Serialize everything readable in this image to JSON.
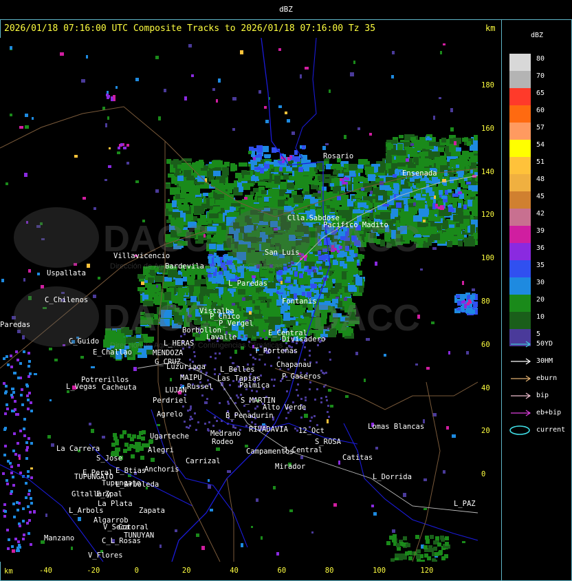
{
  "window": {
    "title": "dBZ"
  },
  "header": {
    "text": "2026/01/18 07:16:00 UTC Composite Tracks to 2026/01/18 07:16:00 Tz 35",
    "unit": "km"
  },
  "legend": {
    "title": "dBZ",
    "scale": [
      {
        "v": "80",
        "c": "#d8d8d8"
      },
      {
        "v": "70",
        "c": "#b4b4b4"
      },
      {
        "v": "65",
        "c": "#ff3a2a"
      },
      {
        "v": "60",
        "c": "#ff6a10"
      },
      {
        "v": "57",
        "c": "#ff9a60"
      },
      {
        "v": "54",
        "c": "#ffff00"
      },
      {
        "v": "51",
        "c": "#ffc23a"
      },
      {
        "v": "48",
        "c": "#f0b040"
      },
      {
        "v": "45",
        "c": "#d08030"
      },
      {
        "v": "42",
        "c": "#c87090"
      },
      {
        "v": "39",
        "c": "#d01ea0"
      },
      {
        "v": "36",
        "c": "#8a2ae0"
      },
      {
        "v": "35",
        "c": "#3050f0"
      },
      {
        "v": "30",
        "c": "#1e8ae0"
      },
      {
        "v": "20",
        "c": "#1a8a1a"
      },
      {
        "v": "10",
        "c": "#1a5e1a"
      },
      {
        "v": "5",
        "c": "#4a3a9a"
      }
    ],
    "tracks": [
      {
        "label": "50YD",
        "color": "#40c8d8"
      },
      {
        "label": "30HM",
        "color": "#ffffff"
      },
      {
        "label": "eburn",
        "color": "#e0b070"
      },
      {
        "label": "bip",
        "color": "#f0c0d0"
      },
      {
        "label": "eb+bip",
        "color": "#e040e0"
      },
      {
        "label": "current",
        "color": "#40e0e8"
      }
    ]
  },
  "axes": {
    "x_unit": "km",
    "x_ticks": [
      "-40",
      "-20",
      "0",
      "20",
      "40",
      "60",
      "80",
      "100",
      "120"
    ],
    "y_ticks": [
      "180",
      "160",
      "140",
      "120",
      "100",
      "80",
      "60",
      "40",
      "20",
      "0"
    ]
  },
  "watermark": {
    "text": "DACC",
    "subtitle": "Dirección de Agricultura y Contingencias Climáticas"
  },
  "places": [
    "Rosario",
    "Ensenada",
    "Clla.Sabdose",
    "Pacifico Madito",
    "San Luis",
    "Villavicencio",
    "Uspallata",
    "C_Chilenos",
    "Paredas",
    "Bardevila",
    "Vistalba",
    "L_Paredas",
    "P_Chico",
    "P_Vergel",
    "Borbollon",
    "Lavalle",
    "C_Guido",
    "E_Challao",
    "L_HERAS",
    "MENDOZA",
    "G_CRUZ",
    "Luzuriaga",
    "MAIPU",
    "Russel",
    "LUJAN",
    "Potrerillos",
    "L_Vegas",
    "Cacheuta",
    "Perdriel",
    "Agrelo",
    "Ugarteche",
    "La Carrera",
    "S_Jose",
    "E_Peral",
    "TUPUNGATO",
    "Tupungato",
    "E_Btias",
    "Anchoris",
    "Carrizal",
    "Gltallary",
    "E_Zpal",
    "L_Arboleda",
    "La Plata",
    "L_Arbols",
    "Zapata",
    "Algarrob",
    "V_Seca",
    "Manzano",
    "TUNUYAN",
    "Cotoral",
    "C_L_Rosas",
    "V_Flores",
    "Medrano",
    "Rodeo",
    "Campamentos",
    "Mirador",
    "L_Dorrida",
    "Catitas",
    "S_ROSA",
    "Lomas Blancas",
    "L_PAZ",
    "12_Oct",
    "Divisadero",
    "E_Central",
    "T_Porteñas",
    "L_Belles",
    "Chapanau",
    "P_Gaseros",
    "Palmica",
    "S_MARTIN",
    "Alto Verde",
    "B_Penadurin",
    "RIVADAVIA",
    "J_Central",
    "Fontanis",
    "Las Tapias",
    "Alegri"
  ]
}
